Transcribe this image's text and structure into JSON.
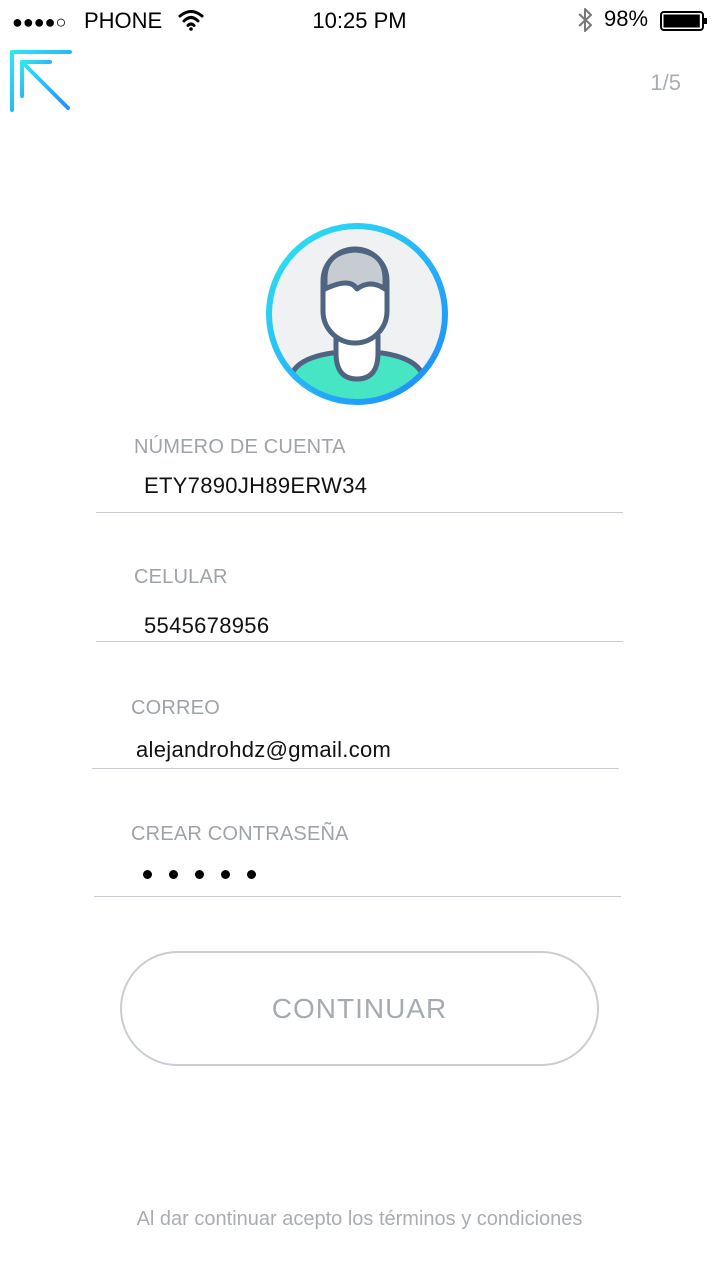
{
  "status_bar": {
    "signal": "●●●●○",
    "carrier": "PHONE",
    "time": "10:25 PM",
    "battery_percent": "98%",
    "battery_level": 0.98,
    "icons": [
      "wifi-icon",
      "bluetooth-icon",
      "battery-icon"
    ]
  },
  "header": {
    "logo_icon": "app-logo-icon",
    "step": "1/5"
  },
  "avatar": {
    "icon": "user-avatar-icon"
  },
  "form": {
    "account": {
      "label": "NÚMERO DE CUENTA",
      "value": "ETY7890JH89ERW34"
    },
    "phone": {
      "label": "CELULAR",
      "value": "5545678956"
    },
    "email": {
      "label": "CORREO",
      "value": "alejandrohdz@gmail.com"
    },
    "password": {
      "label": "CREAR CONTRASEÑA",
      "masked_length": 5
    }
  },
  "continue_button": {
    "label": "CONTINUAR"
  },
  "footer": {
    "terms_text": "Al dar continuar acepto los términos y condiciones"
  },
  "colors": {
    "accent_cyan": "#2ee6f0",
    "accent_blue": "#1fa3ff",
    "avatar_outline": "#4f6480",
    "avatar_shirt": "#46e6c5",
    "label_gray": "#9ea3aa"
  }
}
